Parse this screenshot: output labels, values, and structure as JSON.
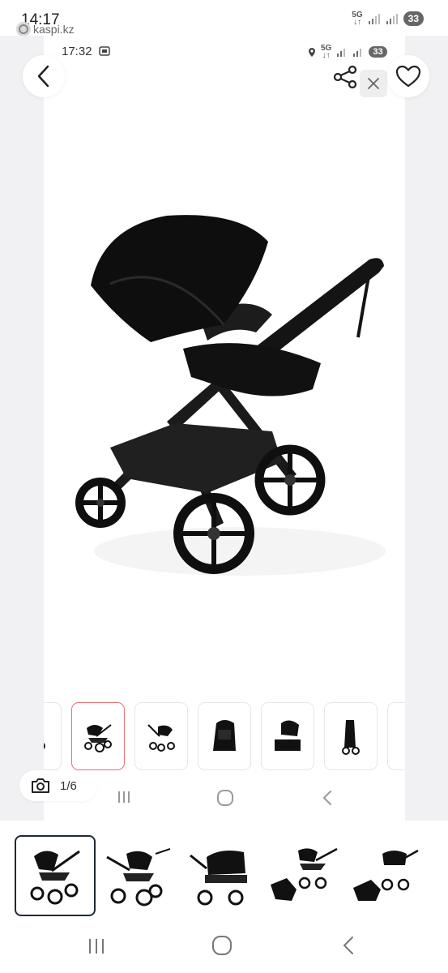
{
  "outer_status": {
    "time": "14:17",
    "app_name": "kaspi.kz",
    "network": "5G",
    "battery": "33"
  },
  "inner_status": {
    "time": "17:32",
    "network": "5G",
    "battery": "33"
  },
  "toolbar": {
    "back_icon": "chevron-left-icon",
    "share_icon": "share-icon",
    "close_icon": "close-icon",
    "favorite_icon": "heart-icon"
  },
  "product": {
    "image": "black-stroller-photo"
  },
  "gallery": {
    "counter": "1/6",
    "camera_icon": "camera-icon",
    "thumbnails": [
      "stroller-side",
      "stroller-side-active",
      "stroller-reverse",
      "bassinet",
      "seat",
      "folded"
    ]
  },
  "bottom_thumbnails": [
    "stroller-main",
    "stroller-reverse",
    "stroller-bassinet",
    "stroller-with-seat",
    "stroller-with-bassinet"
  ],
  "colors": {
    "accent_active": "#e57373",
    "selected_border": "#1e2a36",
    "background_grey": "#f1f1f3"
  }
}
